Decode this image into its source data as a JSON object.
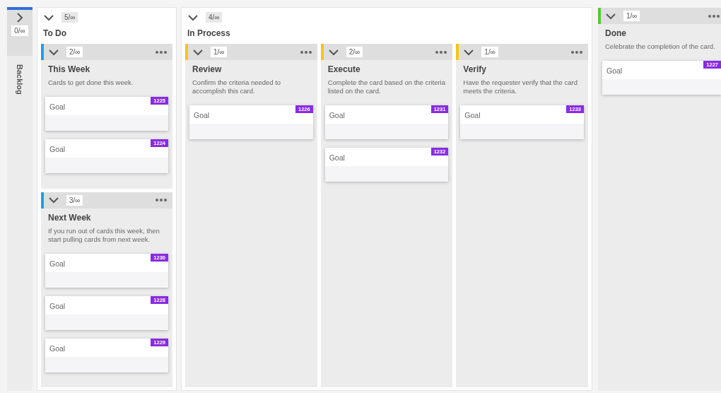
{
  "backlog": {
    "label": "Backlog",
    "count": "0/∞",
    "expanded": false,
    "color": "#2f6fd8"
  },
  "columns": [
    {
      "kind": "stack",
      "title": "To Do",
      "count": "5/∞",
      "expanded": true,
      "lanes": [
        {
          "title": "This Week",
          "count": "2/∞",
          "expanded": true,
          "color": "#1ba1e2",
          "description": "Cards to get done this week.",
          "cards": [
            {
              "title": "Goal",
              "id": "1225"
            },
            {
              "title": "Goal",
              "id": "1224"
            }
          ]
        },
        {
          "title": "Next Week",
          "count": "3/∞",
          "expanded": true,
          "color": "#1ba1e2",
          "description": "If you run out of cards this week, then start pulling cards from next week.",
          "cards": [
            {
              "title": "Goal",
              "id": "1230"
            },
            {
              "title": "Goal",
              "id": "1228"
            },
            {
              "title": "Goal",
              "id": "1229"
            }
          ]
        }
      ]
    },
    {
      "kind": "row",
      "title": "In Process",
      "count": "4/∞",
      "expanded": true,
      "lanes": [
        {
          "title": "Review",
          "count": "1/∞",
          "expanded": true,
          "color": "#f5c518",
          "description": "Confirm the criteria needed to accomplish this card.",
          "cards": [
            {
              "title": "Goal",
              "id": "1226"
            }
          ]
        },
        {
          "title": "Execute",
          "count": "2/∞",
          "expanded": true,
          "color": "#f5c518",
          "description": "Complete the card based on the criteria listed on the card.",
          "cards": [
            {
              "title": "Goal",
              "id": "1231"
            },
            {
              "title": "Goal",
              "id": "1232"
            }
          ]
        },
        {
          "title": "Verify",
          "count": "1/∞",
          "expanded": true,
          "color": "#f5c518",
          "description": "Have the requester verify that the card meets the criteria.",
          "cards": [
            {
              "title": "Goal",
              "id": "1233"
            }
          ]
        }
      ]
    },
    {
      "kind": "lane",
      "title": "Done",
      "count": "1/∞",
      "expanded": true,
      "color": "#5cc33c",
      "description": "Celebrate the completion of the card.",
      "cards": [
        {
          "title": "Goal",
          "id": "1227"
        }
      ]
    }
  ]
}
